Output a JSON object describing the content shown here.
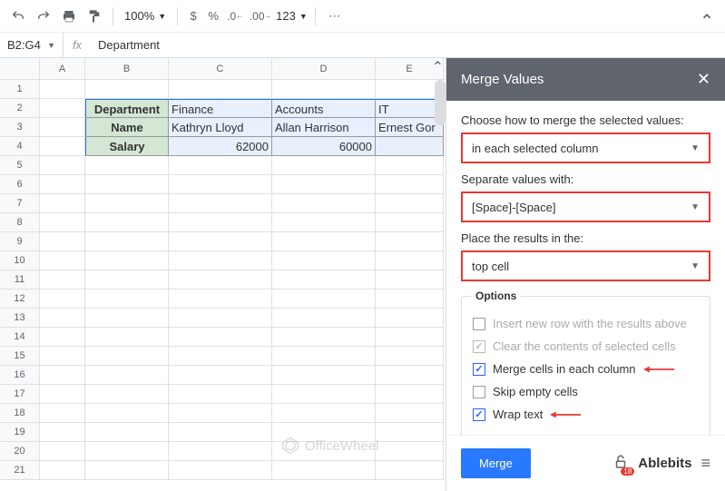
{
  "toolbar": {
    "zoom": "100%",
    "fmt_123": "123"
  },
  "formula": {
    "cellRef": "B2:G4",
    "fx": "fx",
    "value": "Department"
  },
  "cols": [
    "A",
    "B",
    "C",
    "D",
    "E"
  ],
  "rows": [
    1,
    2,
    3,
    4,
    5,
    6,
    7,
    8,
    9,
    10,
    11,
    12,
    13,
    14,
    15,
    16,
    17,
    18,
    19,
    20,
    21
  ],
  "grid": {
    "headers": [
      "Department",
      "Name",
      "Salary"
    ],
    "data": [
      [
        "Finance",
        "Accounts",
        "IT"
      ],
      [
        "Kathryn Lloyd",
        "Allan Harrison",
        "Ernest Gor"
      ],
      [
        "62000",
        "60000",
        ""
      ]
    ]
  },
  "sidebar": {
    "title": "Merge Values",
    "label1": "Choose how to merge the selected values:",
    "select1": "in each selected column",
    "label2": "Separate values with:",
    "select2": "[Space]-[Space]",
    "label3": "Place the results in the:",
    "select3": "top cell",
    "optionsTitle": "Options",
    "opt1": "Insert new row with the results above",
    "opt2": "Clear the contents of selected cells",
    "opt3": "Merge cells in each column",
    "opt4": "Skip empty cells",
    "opt5": "Wrap text",
    "mergeBtn": "Merge",
    "brand": "Ablebits",
    "badge": "18"
  },
  "watermark": "OfficeWheel"
}
